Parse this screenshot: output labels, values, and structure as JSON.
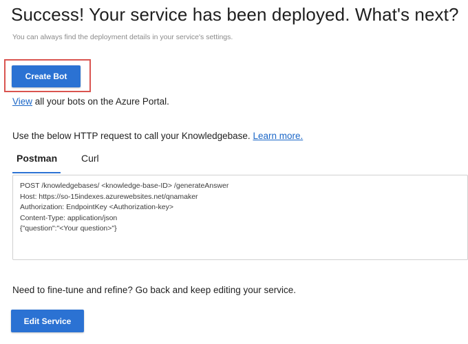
{
  "header": {
    "title": "Success! Your service has been deployed. What's next?",
    "subtitle": "You can always find the deployment details in your service's settings."
  },
  "actions": {
    "create_bot_label": "Create Bot",
    "edit_service_label": "Edit Service"
  },
  "view_line": {
    "link_text": "View",
    "rest_text": " all your bots on the Azure Portal."
  },
  "http_request": {
    "intro_text": "Use the below HTTP request to call your Knowledgebase. ",
    "learn_more_text": "Learn more.",
    "tabs": [
      {
        "label": "Postman",
        "active": true
      },
      {
        "label": "Curl",
        "active": false
      }
    ],
    "code_lines": [
      "POST /knowledgebases/ <knowledge-base-ID> /generateAnswer",
      "Host: https://so-15indexes.azurewebsites.net/qnamaker",
      "Authorization: EndpointKey <Authorization-key>",
      "Content-Type: application/json",
      "{\"question\":\"<Your question>\"}"
    ]
  },
  "fine_tune": {
    "text": "Need to fine-tune and refine? Go back and keep editing your service."
  },
  "colors": {
    "primary_button": "#2b72d3",
    "link": "#1a66c7",
    "highlight_border": "#d9534f"
  }
}
